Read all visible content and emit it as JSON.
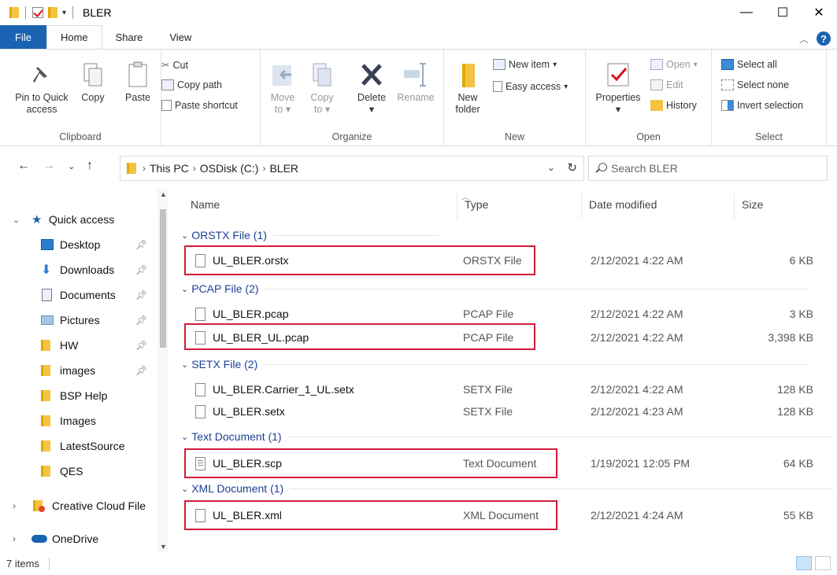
{
  "window": {
    "title": "BLER",
    "controls": [
      "minimize",
      "maximize",
      "close"
    ]
  },
  "ribbon_tabs": [
    "File",
    "Home",
    "Share",
    "View"
  ],
  "ribbon": {
    "clipboard": {
      "label": "Clipboard",
      "pin_quick_access": [
        "Pin to Quick",
        "access"
      ],
      "copy": "Copy",
      "paste": "Paste",
      "cut": "Cut",
      "copy_path": "Copy path",
      "paste_shortcut": "Paste shortcut"
    },
    "organize": {
      "label": "Organize",
      "move_to": [
        "Move",
        "to"
      ],
      "copy_to": [
        "Copy",
        "to"
      ],
      "delete": "Delete",
      "rename": "Rename"
    },
    "new": {
      "label": "New",
      "new_folder": [
        "New",
        "folder"
      ],
      "new_item": "New item",
      "easy_access": "Easy access"
    },
    "open": {
      "label": "Open",
      "properties": "Properties",
      "open": "Open",
      "edit": "Edit",
      "history": "History"
    },
    "select": {
      "label": "Select",
      "select_all": "Select all",
      "select_none": "Select none",
      "invert_selection": "Invert selection"
    }
  },
  "address": {
    "crumbs": [
      "This PC",
      "OSDisk (C:)",
      "BLER"
    ],
    "search_placeholder": "Search BLER"
  },
  "nav": {
    "quick_access": "Quick access",
    "items": [
      {
        "label": "Desktop",
        "icon": "desktop-icon",
        "pinned": true
      },
      {
        "label": "Downloads",
        "icon": "downloads-icon",
        "pinned": true
      },
      {
        "label": "Documents",
        "icon": "documents-icon",
        "pinned": true
      },
      {
        "label": "Pictures",
        "icon": "pictures-icon",
        "pinned": true
      },
      {
        "label": "HW",
        "icon": "folder-icon",
        "pinned": true
      },
      {
        "label": "images",
        "icon": "folder-icon",
        "pinned": true
      },
      {
        "label": "BSP Help",
        "icon": "folder-icon",
        "pinned": false
      },
      {
        "label": "Images",
        "icon": "folder-icon",
        "pinned": false
      },
      {
        "label": "LatestSource",
        "icon": "folder-icon",
        "pinned": false
      },
      {
        "label": "QES",
        "icon": "folder-icon",
        "pinned": false
      }
    ],
    "creative_cloud": "Creative Cloud File",
    "onedrive": "OneDrive"
  },
  "columns": {
    "name": "Name",
    "type": "Type",
    "date": "Date modified",
    "size": "Size"
  },
  "groups": [
    {
      "label": "ORSTX File (1)",
      "files": [
        {
          "name": "UL_BLER.orstx",
          "type": "ORSTX File",
          "date": "2/12/2021 4:22 AM",
          "size": "6 KB",
          "highlighted": true
        }
      ]
    },
    {
      "label": "PCAP File (2)",
      "files": [
        {
          "name": "UL_BLER.pcap",
          "type": "PCAP File",
          "date": "2/12/2021 4:22 AM",
          "size": "3 KB",
          "highlighted": false
        },
        {
          "name": "UL_BLER_UL.pcap",
          "type": "PCAP File",
          "date": "2/12/2021 4:22 AM",
          "size": "3,398 KB",
          "highlighted": true
        }
      ]
    },
    {
      "label": "SETX File (2)",
      "files": [
        {
          "name": "UL_BLER.Carrier_1_UL.setx",
          "type": "SETX File",
          "date": "2/12/2021 4:22 AM",
          "size": "128 KB",
          "highlighted": false
        },
        {
          "name": "UL_BLER.setx",
          "type": "SETX File",
          "date": "2/12/2021 4:23 AM",
          "size": "128 KB",
          "highlighted": false
        }
      ]
    },
    {
      "label": "Text Document (1)",
      "files": [
        {
          "name": "UL_BLER.scp",
          "type": "Text Document",
          "date": "1/19/2021 12:05 PM",
          "size": "64 KB",
          "highlighted": true
        }
      ]
    },
    {
      "label": "XML Document (1)",
      "files": [
        {
          "name": "UL_BLER.xml",
          "type": "XML Document",
          "date": "2/12/2021 4:24 AM",
          "size": "55 KB",
          "highlighted": true
        }
      ]
    }
  ],
  "status": {
    "count": "7 items"
  },
  "colors": {
    "accent": "#1a63b0",
    "group_header": "#1c3f94",
    "highlight_box": "#d21c3a"
  }
}
